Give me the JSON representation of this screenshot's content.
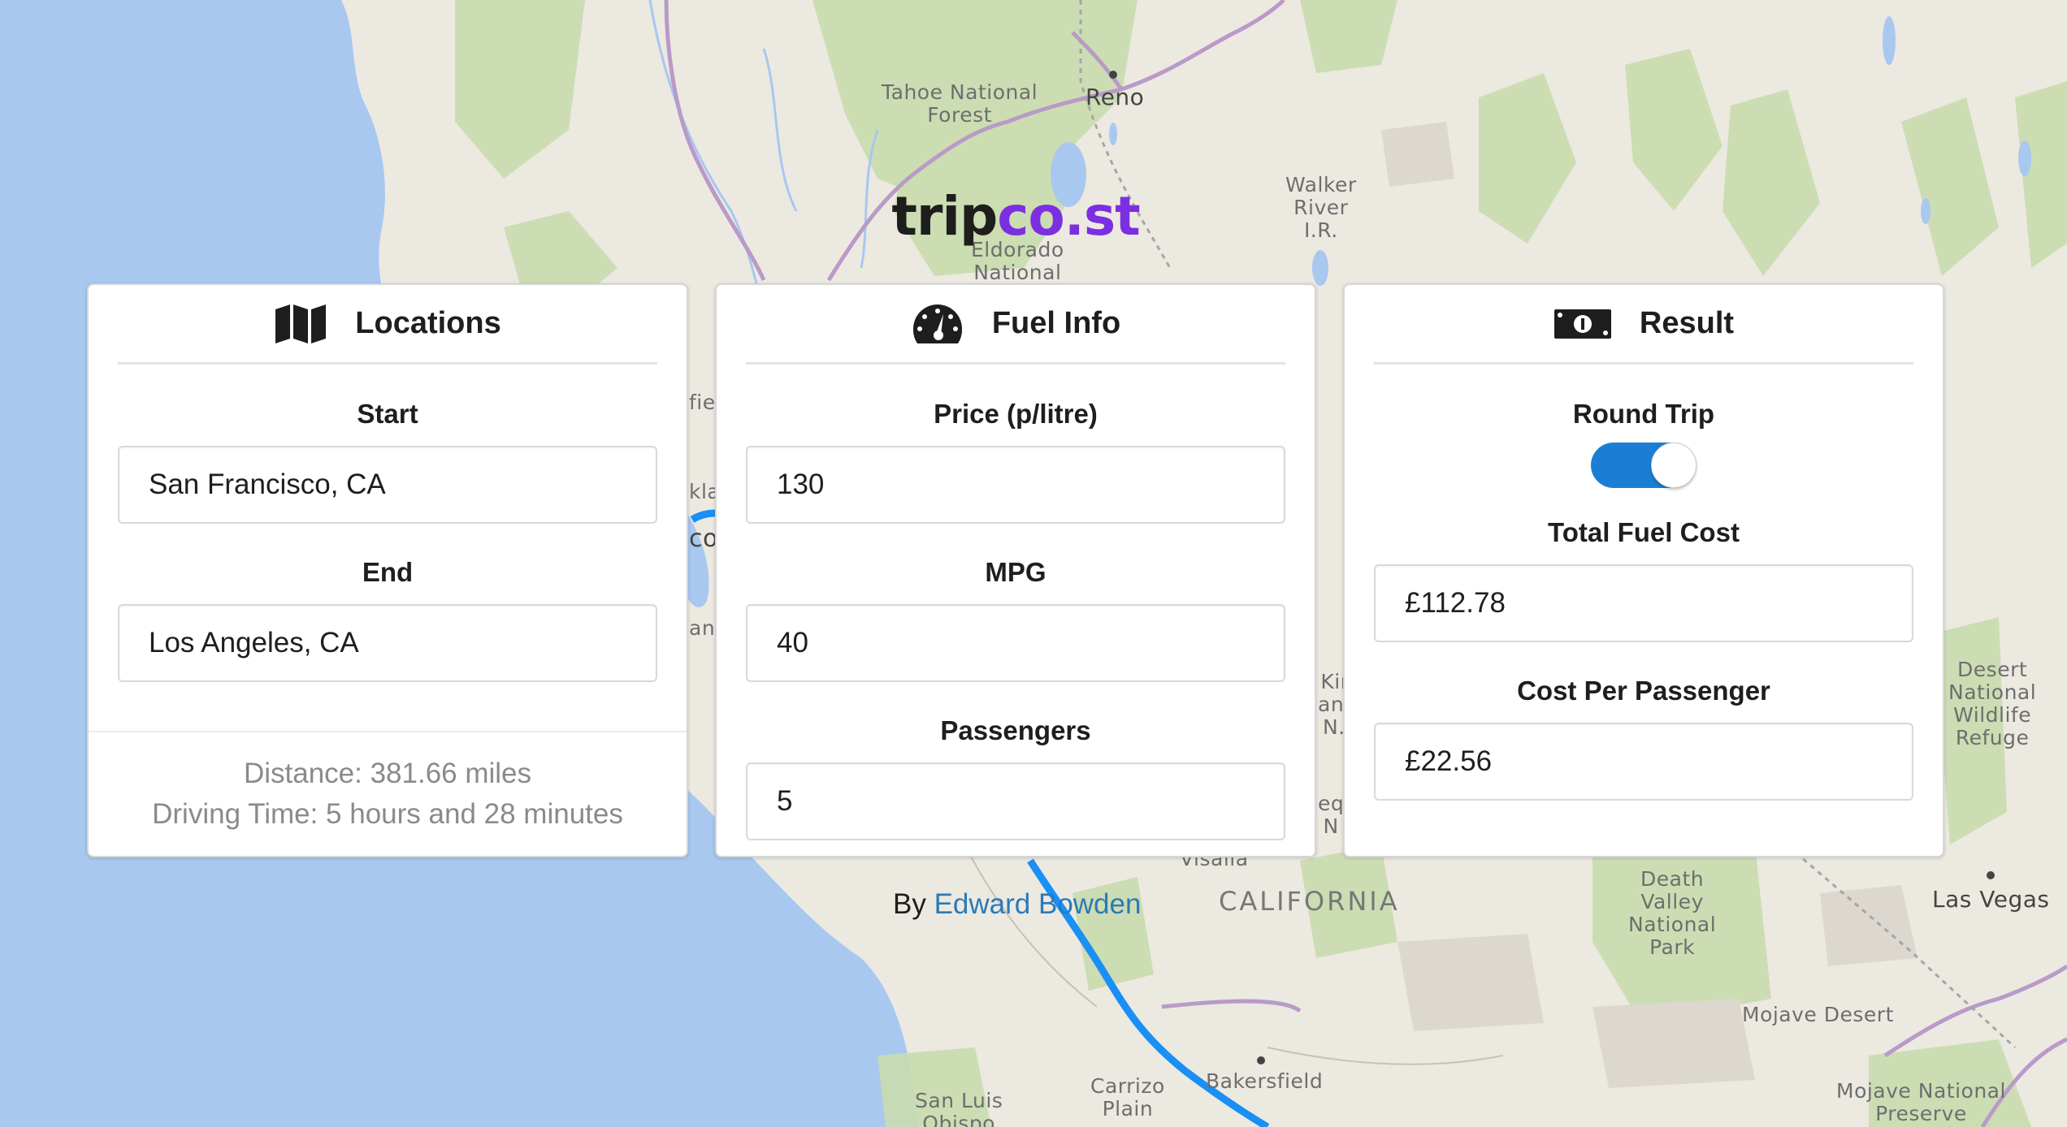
{
  "logo": {
    "part1": "trip",
    "part2": "co.st"
  },
  "colors": {
    "accent": "#7b2fe0",
    "toggle_on": "#1a7fd4",
    "link": "#2a7ab8"
  },
  "locations": {
    "title": "Locations",
    "icon": "map-icon",
    "start_label": "Start",
    "start_value": "San Francisco, CA",
    "end_label": "End",
    "end_value": "Los Angeles, CA",
    "distance": "Distance: 381.66 miles",
    "driving_time": "Driving Time: 5 hours and 28 minutes"
  },
  "fuel": {
    "title": "Fuel Info",
    "icon": "speedometer-icon",
    "price_label": "Price (p/litre)",
    "price_value": "130",
    "mpg_label": "MPG",
    "mpg_value": "40",
    "passengers_label": "Passengers",
    "passengers_value": "5"
  },
  "result": {
    "title": "Result",
    "icon": "money-icon",
    "round_trip_label": "Round Trip",
    "round_trip_on": true,
    "total_label": "Total Fuel Cost",
    "total_value": "£112.78",
    "per_passenger_label": "Cost Per Passenger",
    "per_passenger_value": "£22.56"
  },
  "credit": {
    "prefix": "By ",
    "author": "Edward Bowden"
  },
  "map_labels": {
    "tahoe": "Tahoe National\nForest",
    "reno": "Reno",
    "walker": "Walker\nRiver\nI.R.",
    "eldorado": "Eldorado\nNational",
    "desert_refuge": "Desert\nNational\nWildlife\nRefuge",
    "las_vegas": "Las Vegas",
    "death_valley": "Death\nValley\nNational\nPark",
    "california": "CALIFORNIA",
    "visalia": "Visalia",
    "mojave_desert": "Mojave Desert",
    "bakersfield": "Bakersfield",
    "carrizo": "Carrizo\nPlain",
    "san_luis": "San Luis\nObispo",
    "mojave_preserve": "Mojave National\nPreserve",
    "oakland_frag": "kla",
    "co_frag": "co",
    "an_frag": "an",
    "fie_frag": "fie",
    "kin_frag": "Kin\nany\nN.I",
    "seq_frag": "eq\nN"
  }
}
